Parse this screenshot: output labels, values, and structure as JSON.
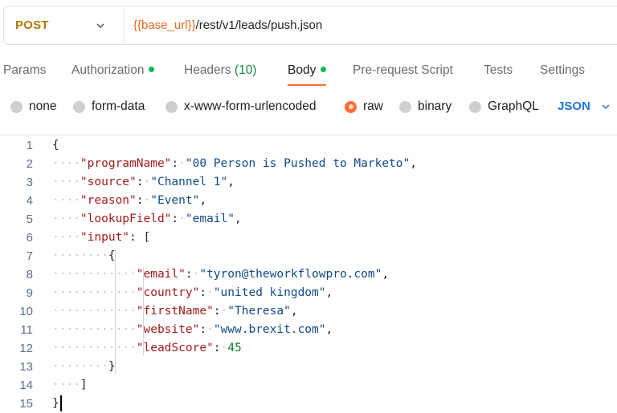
{
  "request": {
    "method": "POST",
    "url_variable": "{{base_url}}",
    "url_path": "/rest/v1/leads/push.json"
  },
  "tabs": [
    {
      "label": "Params"
    },
    {
      "label": "Authorization",
      "dot": true
    },
    {
      "label": "Headers",
      "count": "(10)"
    },
    {
      "label": "Body",
      "dot": true,
      "active": true
    },
    {
      "label": "Pre-request Script"
    },
    {
      "label": "Tests"
    },
    {
      "label": "Settings"
    }
  ],
  "body_types": [
    {
      "label": "none"
    },
    {
      "label": "form-data"
    },
    {
      "label": "x-www-form-urlencoded"
    },
    {
      "label": "raw",
      "selected": true
    },
    {
      "label": "binary"
    },
    {
      "label": "GraphQL"
    }
  ],
  "body_format": "JSON",
  "colors": {
    "accent": "#ff6c37",
    "method_post": "#ad7a03",
    "variable": "#e66a1f",
    "status_dot": "#0cbb52",
    "json_key": "#a11b1b",
    "json_string": "#0f4a86",
    "json_number": "#0f7d2f",
    "format_link": "#1d74d9"
  },
  "icons": {
    "method_dropdown": "chevron-down-icon",
    "format_dropdown": "chevron-down-icon"
  },
  "editor": {
    "line_numbers": [
      "1",
      "2",
      "3",
      "4",
      "5",
      "6",
      "7",
      "8",
      "9",
      "10",
      "11",
      "12",
      "13",
      "14",
      "15"
    ],
    "lines": [
      [
        {
          "t": "p",
          "v": "{"
        }
      ],
      [
        {
          "t": "k",
          "v": "\"programName\""
        },
        {
          "t": "p",
          "v": ":"
        },
        {
          "t": "s",
          "v": "\"00 Person is Pushed to Marketo\""
        },
        {
          "t": "p",
          "v": ","
        }
      ],
      [
        {
          "t": "k",
          "v": "\"source\""
        },
        {
          "t": "p",
          "v": ":"
        },
        {
          "t": "s",
          "v": "\"Channel 1\""
        },
        {
          "t": "p",
          "v": ","
        }
      ],
      [
        {
          "t": "k",
          "v": "\"reason\""
        },
        {
          "t": "p",
          "v": ":"
        },
        {
          "t": "s",
          "v": "\"Event\""
        },
        {
          "t": "p",
          "v": ","
        }
      ],
      [
        {
          "t": "k",
          "v": "\"lookupField\""
        },
        {
          "t": "p",
          "v": ":"
        },
        {
          "t": "s",
          "v": "\"email\""
        },
        {
          "t": "p",
          "v": ","
        }
      ],
      [
        {
          "t": "k",
          "v": "\"input\""
        },
        {
          "t": "p",
          "v": ":"
        },
        {
          "t": "p",
          "v": "["
        }
      ],
      [
        {
          "t": "p",
          "v": "{"
        }
      ],
      [
        {
          "t": "k",
          "v": "\"email\""
        },
        {
          "t": "p",
          "v": ":"
        },
        {
          "t": "s",
          "v": "\"tyron@theworkflowpro.com\""
        },
        {
          "t": "p",
          "v": ","
        }
      ],
      [
        {
          "t": "k",
          "v": "\"country\""
        },
        {
          "t": "p",
          "v": ":"
        },
        {
          "t": "s",
          "v": "\"united kingdom\""
        },
        {
          "t": "p",
          "v": ","
        }
      ],
      [
        {
          "t": "k",
          "v": "\"firstName\""
        },
        {
          "t": "p",
          "v": ":"
        },
        {
          "t": "s",
          "v": "\"Theresa\""
        },
        {
          "t": "p",
          "v": ","
        }
      ],
      [
        {
          "t": "k",
          "v": "\"website\""
        },
        {
          "t": "p",
          "v": ":"
        },
        {
          "t": "s",
          "v": "\"www.brexit.com\""
        },
        {
          "t": "p",
          "v": ","
        }
      ],
      [
        {
          "t": "k",
          "v": "\"leadScore\""
        },
        {
          "t": "p",
          "v": ":"
        },
        {
          "t": "n",
          "v": "45"
        }
      ],
      [
        {
          "t": "p",
          "v": "}"
        }
      ],
      [
        {
          "t": "p",
          "v": "]"
        }
      ],
      [
        {
          "t": "p",
          "v": "}"
        }
      ]
    ]
  }
}
